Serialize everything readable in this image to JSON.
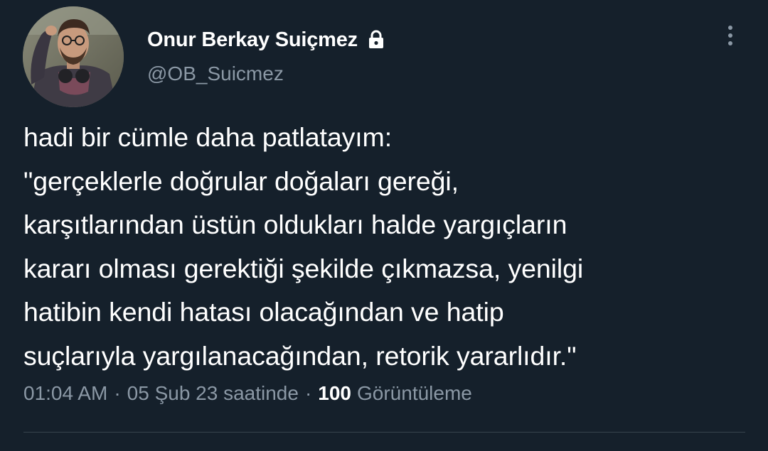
{
  "author": {
    "display_name": "Onur Berkay Suiçmez",
    "handle": "@OB_Suicmez",
    "protected_icon": "lock-icon",
    "avatar_icon": "profile-photo"
  },
  "more_icon": "vertical-ellipsis-icon",
  "tweet": {
    "lines": [
      "hadi bir cümle daha patlatayım:",
      "\"gerçeklerle doğrular doğaları gereği,",
      "karşıtlarından üstün oldukları halde yargıçların",
      "kararı olması gerektiği şekilde çıkmazsa, yenilgi",
      "hatibin kendi hatası olacağından ve hatip",
      "suçlarıyla yargılanacağından, retorik yararlıdır.\""
    ]
  },
  "meta": {
    "time": "01:04 AM",
    "separator": "·",
    "date": "05 Şub 23 saatinde",
    "views_count": "100",
    "views_label": "Görüntüleme"
  },
  "colors": {
    "background": "#15202b",
    "primary_text": "#ffffff",
    "secondary_text": "#8b98a5",
    "divider": "#38444d"
  }
}
